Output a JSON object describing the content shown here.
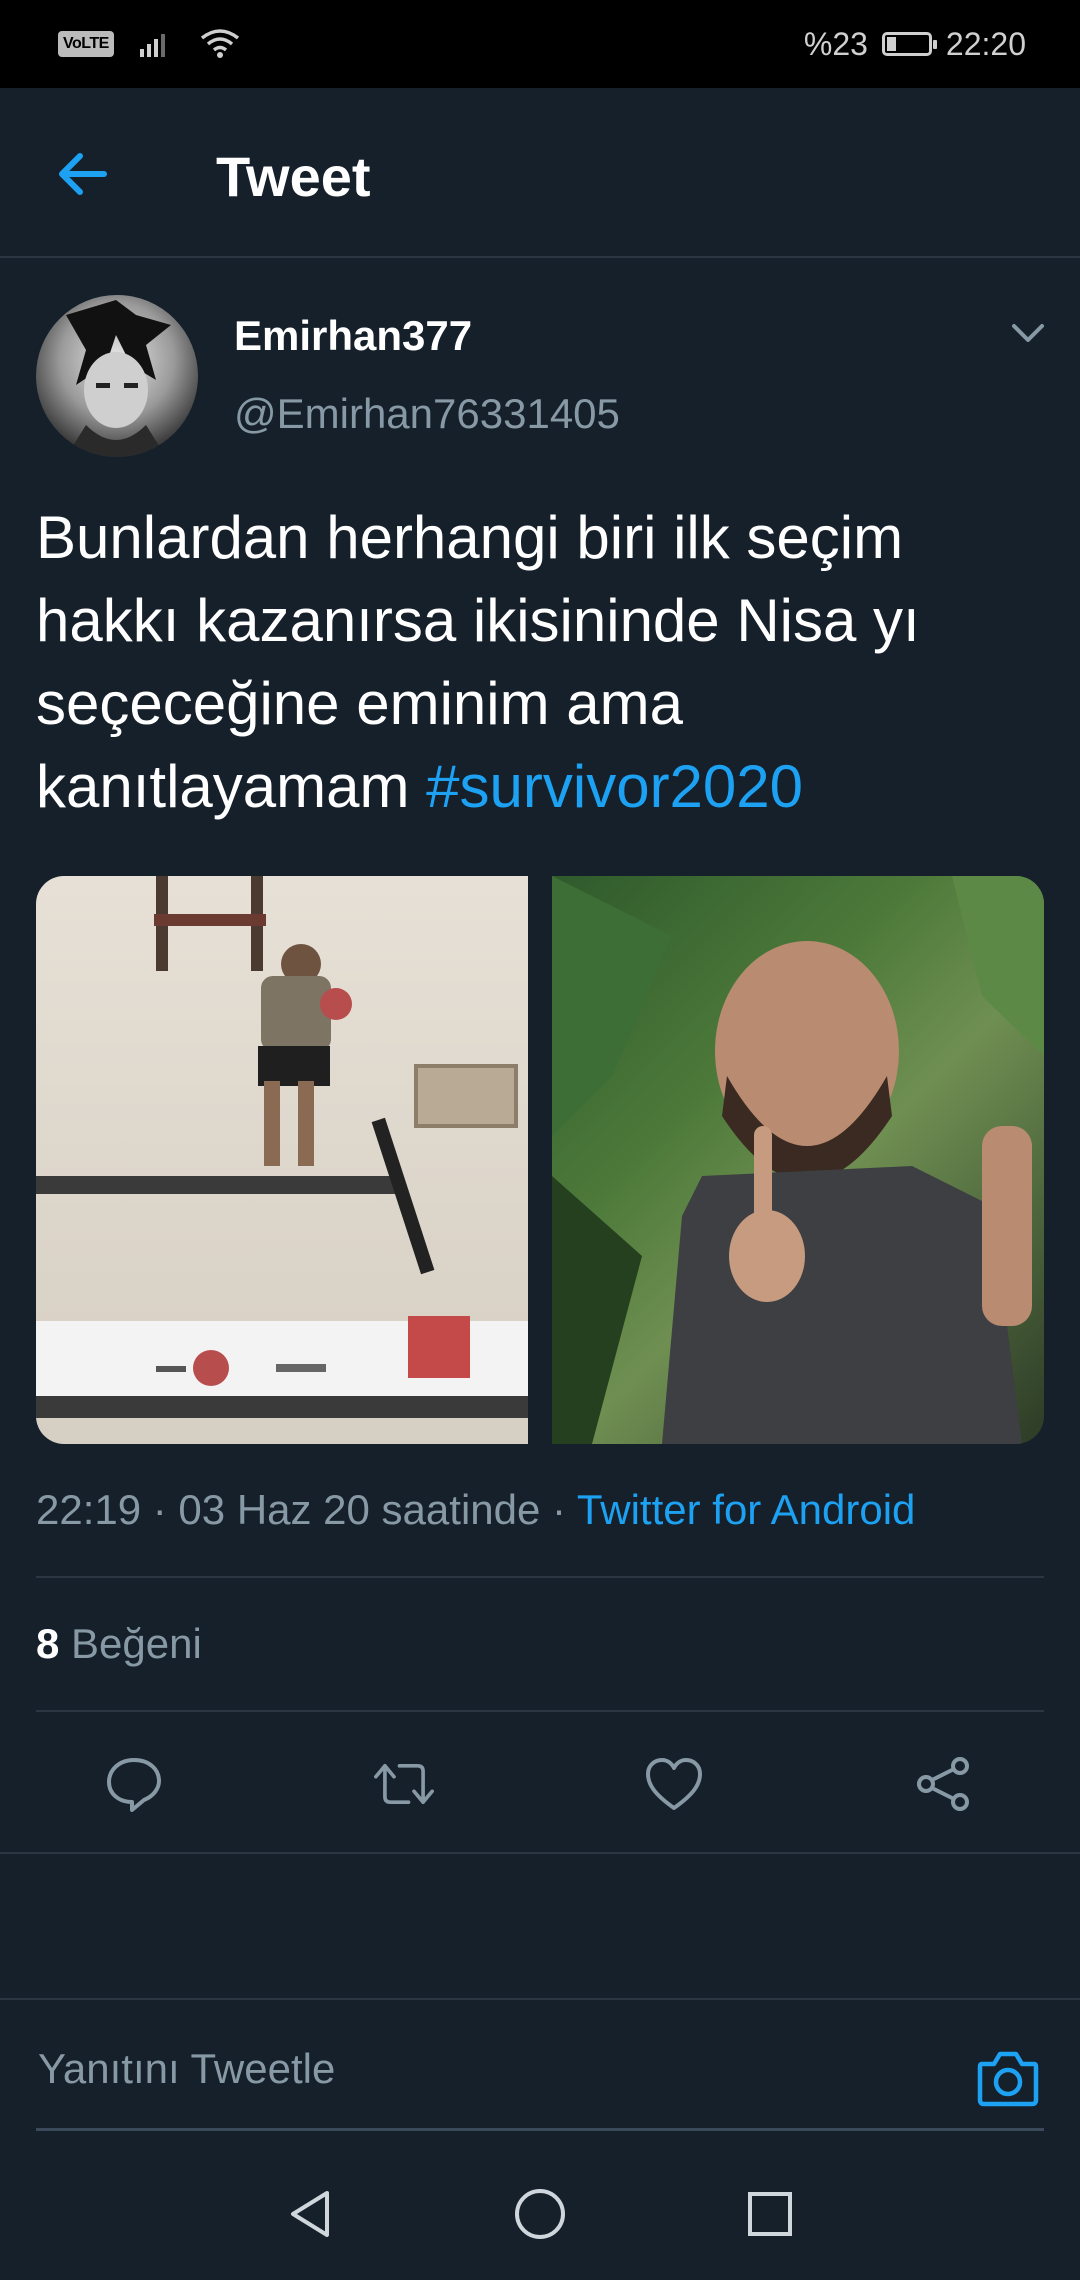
{
  "status_bar": {
    "volte": "VoLTE",
    "battery_percent": "%23",
    "battery_level": 0.23,
    "time": "22:20"
  },
  "header": {
    "title": "Tweet",
    "icons": [
      "back-arrow-icon"
    ]
  },
  "tweet": {
    "display_name": "Emirhan377",
    "handle": "@Emirhan76331405",
    "text": "Bunlardan herhangi biri ilk seçim hakkı kazanırsa ikisininde Nisa yı seçeceğine eminim ama kanıtlayamam ",
    "hashtag": "#survivor2020",
    "timestamp": "22:19 · 03 Haz 20 saatinde · ",
    "source": "Twitter for Android",
    "likes_count": "8",
    "likes_label": " Beğeni"
  },
  "actions": [
    "reply-icon",
    "retweet-icon",
    "like-icon",
    "share-icon"
  ],
  "reply": {
    "placeholder": "Yanıtını Tweetle"
  },
  "colors": {
    "background": "#15202b",
    "accent": "#1da1f2",
    "secondary_text": "#8899a6",
    "divider": "#2a3642"
  }
}
